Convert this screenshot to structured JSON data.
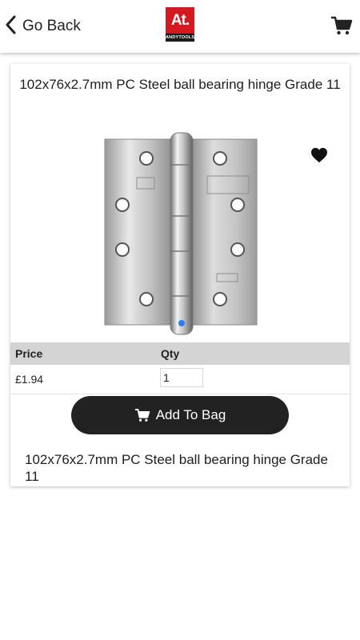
{
  "header": {
    "back_label": "Go Back",
    "logo_text": "At.",
    "logo_subtext": "ANDYTOOLS"
  },
  "product": {
    "title": "102x76x2.7mm PC Steel ball bearing hinge Grade 11",
    "description": "102x76x2.7mm PC Steel ball bearing hinge Grade 11",
    "image_alt": "steel ball bearing hinge"
  },
  "table": {
    "price_header": "Price",
    "qty_header": "Qty",
    "price_value": "£1.94",
    "qty_value": "1"
  },
  "actions": {
    "add_to_bag_label": "Add To Bag"
  },
  "colors": {
    "brand_red": "#d41920",
    "button_dark": "#222222",
    "table_header_bg": "#d4d4d4"
  },
  "icons": {
    "back": "chevron-left-icon",
    "cart": "cart-icon",
    "favorite": "heart-icon",
    "add_to_bag": "cart-icon"
  }
}
